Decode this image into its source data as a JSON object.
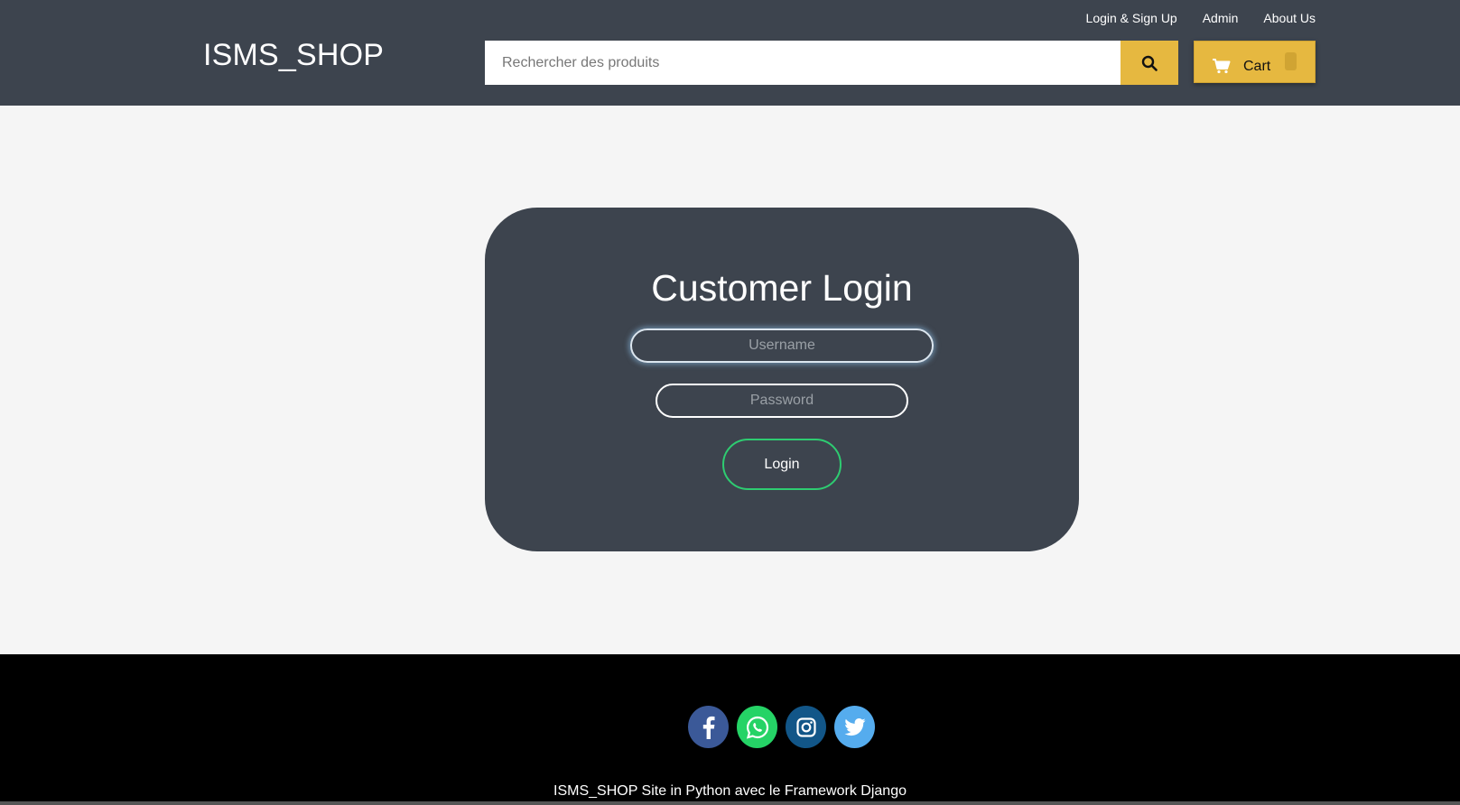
{
  "header": {
    "brand": "ISMS_SHOP",
    "nav": [
      {
        "label": "Login & Sign Up"
      },
      {
        "label": "Admin"
      },
      {
        "label": "About Us"
      }
    ],
    "search": {
      "placeholder": "Rechercher des produits",
      "value": "",
      "icon": "search-icon"
    },
    "cart": {
      "label": "Cart",
      "icon": "cart-icon"
    }
  },
  "login": {
    "title": "Customer Login",
    "username_placeholder": "Username",
    "password_placeholder": "Password",
    "button_label": "Login"
  },
  "footer": {
    "socials": [
      {
        "name": "facebook",
        "icon": "facebook-icon",
        "color": "#3b5998"
      },
      {
        "name": "whatsapp",
        "icon": "whatsapp-icon",
        "color": "#25d366"
      },
      {
        "name": "instagram",
        "icon": "instagram-icon",
        "color": "#125688"
      },
      {
        "name": "twitter",
        "icon": "twitter-icon",
        "color": "#55acee"
      }
    ],
    "text": "ISMS_SHOP Site in Python avec le Framework Django"
  },
  "colors": {
    "header_bg": "#3d444e",
    "accent": "#e6b840",
    "login_button_border": "#2ecc71",
    "footer_bg": "#000000"
  }
}
